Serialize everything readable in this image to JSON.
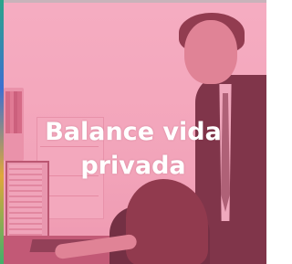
{
  "tile": {
    "title_line1": "Balance vida",
    "title_line2": "privada",
    "overlay_color": "#ec5480",
    "text_color": "#ffffff"
  }
}
